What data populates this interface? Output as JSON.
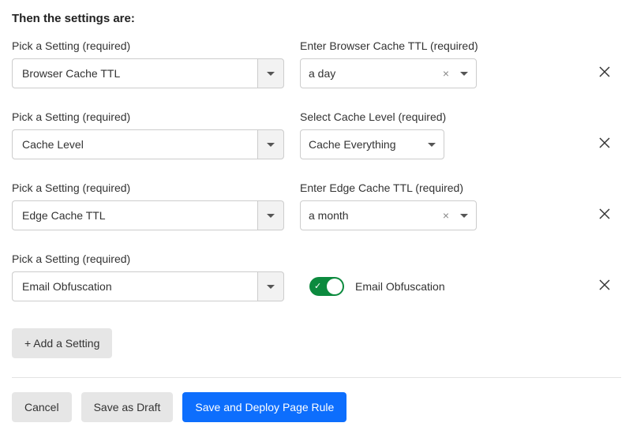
{
  "heading": "Then the settings are:",
  "rows": [
    {
      "picklabel": "Pick a Setting (required)",
      "picked": "Browser Cache TTL",
      "value_label": "Enter Browser Cache TTL (required)",
      "value": "a day"
    },
    {
      "picklabel": "Pick a Setting (required)",
      "picked": "Cache Level",
      "value_label": "Select Cache Level (required)",
      "value": "Cache Everything"
    },
    {
      "picklabel": "Pick a Setting (required)",
      "picked": "Edge Cache TTL",
      "value_label": "Enter Edge Cache TTL (required)",
      "value": "a month"
    },
    {
      "picklabel": "Pick a Setting (required)",
      "picked": "Email Obfuscation",
      "toggle_label": "Email Obfuscation",
      "toggle_on": true
    }
  ],
  "buttons": {
    "add_setting": "+ Add a Setting",
    "cancel": "Cancel",
    "save_draft": "Save as Draft",
    "save_deploy": "Save and Deploy Page Rule"
  }
}
